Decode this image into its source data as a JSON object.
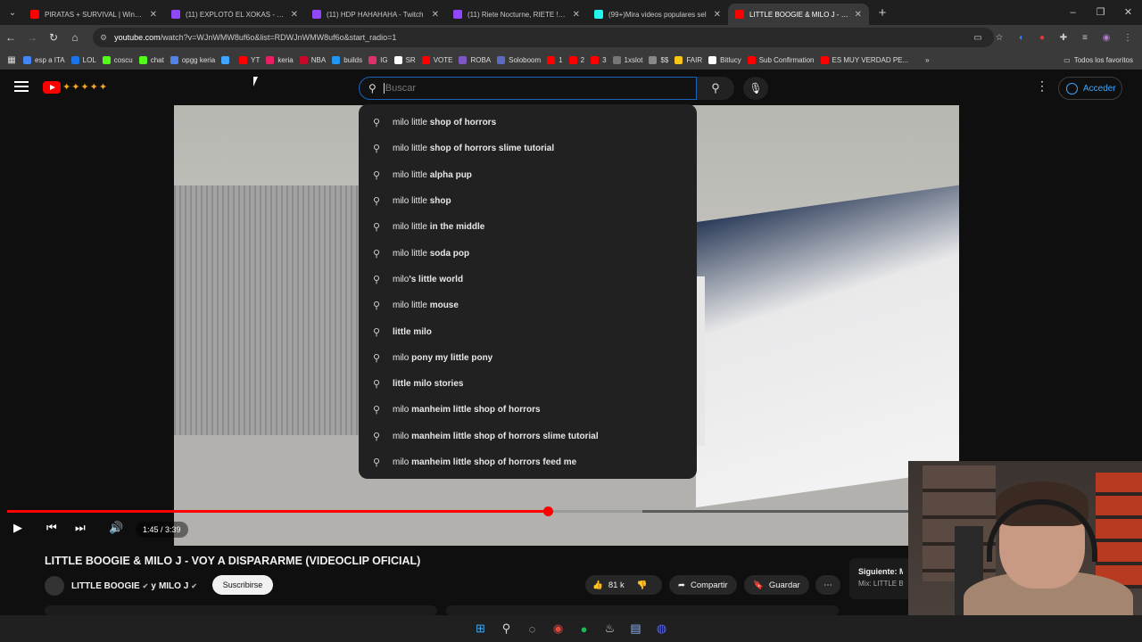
{
  "browser": {
    "tabs": [
      {
        "title": "PIRATAS + SURVIVAL | WindRo",
        "color": "#ff0000"
      },
      {
        "title": "(11) EXPLOTÓ EL XOKAS - Twitc",
        "color": "#9146ff"
      },
      {
        "title": "(11) HDP HAHAHAHA - Twitch",
        "color": "#9146ff"
      },
      {
        "title": "(11) Riete Nocturne, RIETE ! xdd",
        "color": "#9146ff"
      },
      {
        "title": "(99+)Mira videos populares sel",
        "color": "#25f4ee"
      },
      {
        "title": "LITTLE BOOGIE & MILO J - VOY",
        "color": "#ff0000"
      }
    ],
    "new_tab": "+",
    "window_controls": [
      "–",
      "❐",
      "✕"
    ],
    "url_host": "youtube.com",
    "url_path": "/watch?v=WJnWMW8uf6o&list=RDWJnWMW8uf6o&start_radio=1",
    "bookmarks": [
      {
        "label": "esp a ITA",
        "color": "#4285f4"
      },
      {
        "label": "LOL",
        "color": "#1a73e8"
      },
      {
        "label": "coscu",
        "color": "#53fc18"
      },
      {
        "label": "chat",
        "color": "#53fc18"
      },
      {
        "label": "opgg keria",
        "color": "#5383e8"
      },
      {
        "label": "",
        "color": "#3ea6ff"
      },
      {
        "label": "YT",
        "color": "#ff0000"
      },
      {
        "label": "keria",
        "color": "#e91e63"
      },
      {
        "label": "NBA",
        "color": "#c9082a"
      },
      {
        "label": "builds",
        "color": "#2196f3"
      },
      {
        "label": "IG",
        "color": "#e1306c"
      },
      {
        "label": "SR",
        "color": "#ffffff"
      },
      {
        "label": "VOTE",
        "color": "#ff0000"
      },
      {
        "label": "ROBA",
        "color": "#7e57c2"
      },
      {
        "label": "Soloboom",
        "color": "#5c6bc0"
      },
      {
        "label": "1",
        "color": "#ff0000"
      },
      {
        "label": "2",
        "color": "#ff0000"
      },
      {
        "label": "3",
        "color": "#ff0000"
      },
      {
        "label": "1xslot",
        "color": "#777777"
      },
      {
        "label": "$$",
        "color": "#888888"
      },
      {
        "label": "FAIR",
        "color": "#f5c518"
      },
      {
        "label": "Bitlucy",
        "color": "#ffffff"
      },
      {
        "label": "Sub Confirmation",
        "color": "#ff0000"
      },
      {
        "label": "ES MUY VERDAD PE...",
        "color": "#ff0000"
      }
    ],
    "all_bookmarks": "Todos los favoritos"
  },
  "youtube": {
    "search_placeholder": "Buscar",
    "signin": "Acceder",
    "suggestions": [
      {
        "pre": "milo little ",
        "bold": "shop of horrors"
      },
      {
        "pre": "milo little ",
        "bold": "shop of horrors slime tutorial"
      },
      {
        "pre": "milo little ",
        "bold": "alpha pup"
      },
      {
        "pre": "milo little ",
        "bold": "shop"
      },
      {
        "pre": "milo little ",
        "bold": "in the middle"
      },
      {
        "pre": "milo little ",
        "bold": "soda pop"
      },
      {
        "pre": "milo",
        "bold": "'s little world"
      },
      {
        "pre": "milo little ",
        "bold": "mouse"
      },
      {
        "pre": "",
        "bold": "little milo"
      },
      {
        "pre": "milo ",
        "bold": "pony my little pony"
      },
      {
        "pre": "",
        "bold": "little milo stories"
      },
      {
        "pre": "milo ",
        "bold": "manheim little shop of horrors"
      },
      {
        "pre": "milo ",
        "bold": "manheim little shop of horrors slime tutorial"
      },
      {
        "pre": "milo ",
        "bold": "manheim little shop of horrors feed me"
      }
    ],
    "player": {
      "time": "1:45 / 3:39",
      "progress": 0.6,
      "buffered": 0.705
    },
    "video_title": "LITTLE BOOGIE & MILO J - VOY A DISPARARME (VIDEOCLIP OFICIAL)",
    "channel": "LITTLE BOOGIE",
    "channel_join": "y",
    "channel2": "MILO J",
    "subscribe": "Suscribirse",
    "likes": "81 k",
    "share": "Compartir",
    "save": "Guardar",
    "next_label": "Siguiente: Mi",
    "next_sub": "Mix: LITTLE BOO"
  }
}
